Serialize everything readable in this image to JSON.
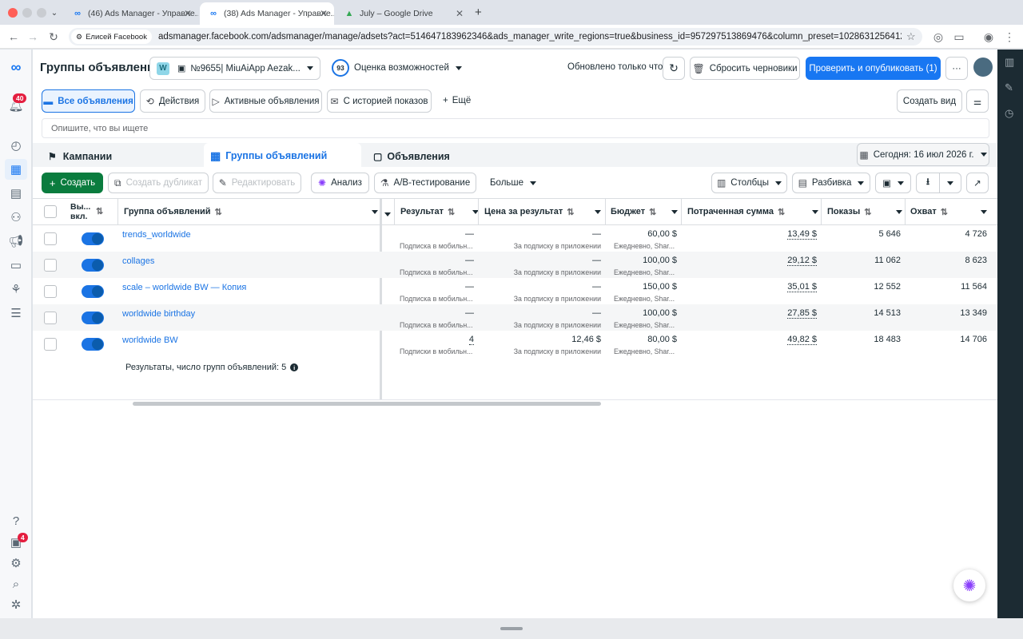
{
  "browser": {
    "tabs": [
      {
        "title": "(46) Ads Manager - Управле...",
        "active": false
      },
      {
        "title": "(38) Ads Manager - Управле...",
        "active": true
      },
      {
        "title": "July – Google Drive",
        "active": false
      }
    ],
    "new_tab": "+",
    "profile_chip": "Елисей Facebook",
    "url": "adsmanager.facebook.com/adsmanager/manage/adsets?act=514647183962346&ads_manager_write_regions=true&business_id=957297513869476&column_preset=1028631256412814&date=..."
  },
  "nav": {
    "notif_badge": "40",
    "bottom_badge": "4",
    "help": "?"
  },
  "header": {
    "title": "Группы объявлений",
    "account_letter": "W",
    "account_name": "№9655| MiuAiApp Aezak...",
    "score": "93",
    "score_label": "Оценка возможностей",
    "updated": "Обновлено только что",
    "reset_label": "Сбросить черновики",
    "publish_label": "Проверить и опубликовать (1)",
    "more": "···"
  },
  "filters": {
    "all_ads": "Все объявления",
    "actions": "Действия",
    "active_ads": "Активные объявления",
    "with_history": "С историей показов",
    "more": "Ещё",
    "create_view": "Создать вид",
    "search_placeholder": "Опишите, что вы ищете"
  },
  "levels": {
    "campaigns": "Кампании",
    "adsets": "Группы объявлений",
    "ads": "Объявления",
    "date": "Сегодня: 16 июл 2026 г."
  },
  "actions": {
    "create": "Создать",
    "duplicate": "Создать дубликат",
    "edit": "Редактировать",
    "analyze": "Анализ",
    "ab": "A/B-тестирование",
    "more": "Больше",
    "columns": "Столбцы",
    "breakdown": "Разбивка"
  },
  "table": {
    "headers": {
      "onoff": "Вы... вкл.",
      "name": "Группа объявлений",
      "result": "Результат",
      "cpr": "Цена за результат",
      "budget": "Бюджет",
      "spent": "Потраченная сумма",
      "impr": "Показы",
      "reach": "Охват"
    },
    "rows": [
      {
        "name": "trends_worldwide",
        "result": "—",
        "result_sub": "Подписка в мобильн...",
        "cpr": "—",
        "cpr_sub": "За подписку в приложении",
        "budget": "60,00 $",
        "budget_sub": "Ежедневно, Shar...",
        "spent": "13,49 $",
        "impr": "5 646",
        "reach": "4 726"
      },
      {
        "name": "collages",
        "result": "—",
        "result_sub": "Подписка в мобильн...",
        "cpr": "—",
        "cpr_sub": "За подписку в приложении",
        "budget": "100,00 $",
        "budget_sub": "Ежедневно, Shar...",
        "spent": "29,12 $",
        "impr": "11 062",
        "reach": "8 623"
      },
      {
        "name": "scale – worldwide BW — Копия",
        "result": "—",
        "result_sub": "Подписка в мобильн...",
        "cpr": "—",
        "cpr_sub": "За подписку в приложении",
        "budget": "150,00 $",
        "budget_sub": "Ежедневно, Shar...",
        "spent": "35,01 $",
        "impr": "12 552",
        "reach": "11 564"
      },
      {
        "name": "worldwide birthday",
        "result": "—",
        "result_sub": "Подписка в мобильн...",
        "cpr": "—",
        "cpr_sub": "За подписку в приложении",
        "budget": "100,00 $",
        "budget_sub": "Ежедневно, Shar...",
        "spent": "27,85 $",
        "impr": "14 513",
        "reach": "13 349"
      },
      {
        "name": "worldwide BW",
        "result": "4",
        "result_sub": "Подписки в мобильн...",
        "cpr": "12,46 $",
        "cpr_sub": "За подписку в приложении",
        "budget": "80,00 $",
        "budget_sub": "Ежедневно, Shar...",
        "spent": "49,82 $",
        "impr": "18 483",
        "reach": "14 706"
      }
    ],
    "summary": "Результаты, число групп объявлений: 5"
  },
  "colors": {
    "accent": "#1b74e4",
    "create": "#0a7c3e",
    "publish": "#1877f2",
    "dark_strip": "#1c2b33"
  }
}
